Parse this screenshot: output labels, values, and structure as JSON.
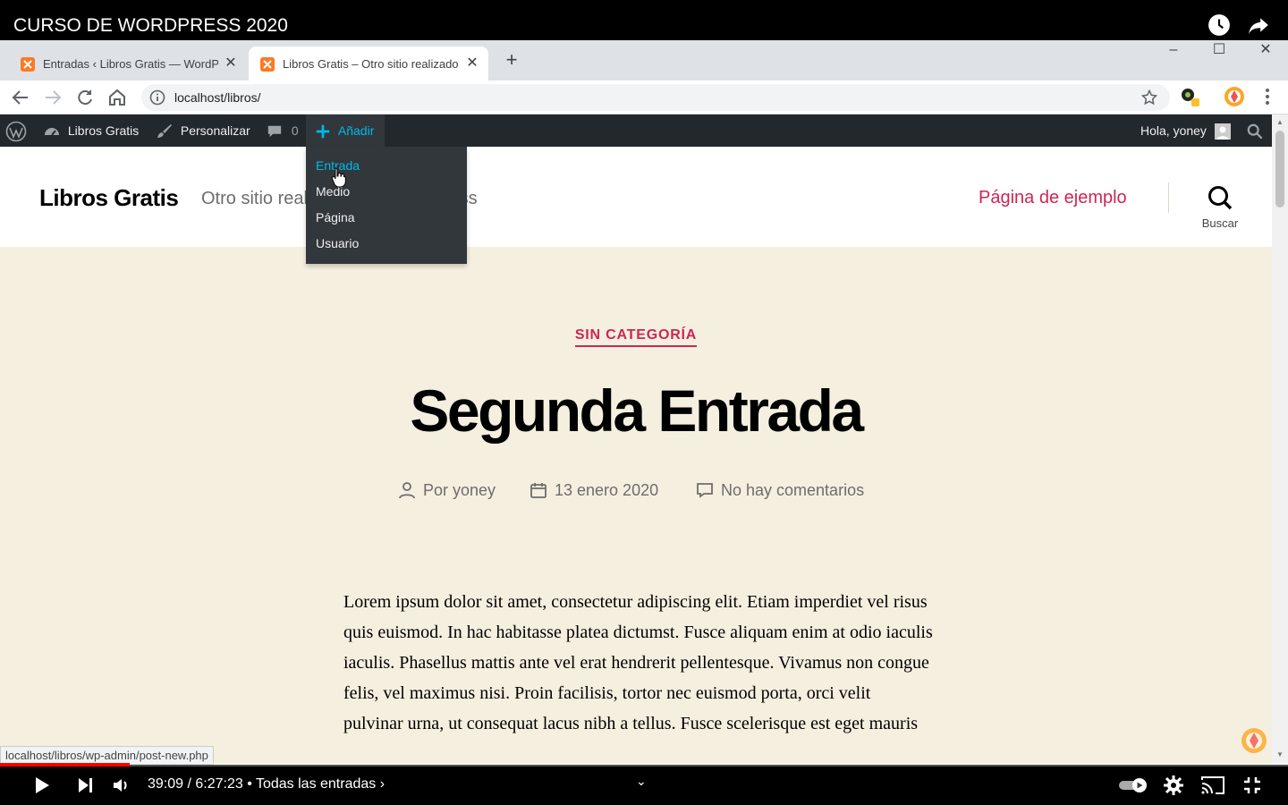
{
  "youtube": {
    "title": "CURSO DE WORDPRESS 2020",
    "time": "39:09 / 6:27:23",
    "chapter": " • Todas las entradas ›",
    "progress_fraction": 0.101
  },
  "browser": {
    "tabs": [
      {
        "label": "Entradas ‹ Libros Gratis — WordPress",
        "active": false
      },
      {
        "label": "Libros Gratis – Otro sitio realizado con WordPress",
        "active": true
      }
    ],
    "url": "localhost/libros/",
    "status_url": "localhost/libros/wp-admin/post-new.php"
  },
  "adminbar": {
    "site_name": "Libros Gratis",
    "customize": "Personalizar",
    "comments_count": "0",
    "add_new": "Añadir",
    "greeting": "Hola, yoney"
  },
  "add_menu": {
    "items": [
      "Entrada",
      "Medio",
      "Página",
      "Usuario"
    ]
  },
  "site": {
    "title": "Libros Gratis",
    "description": "Otro sitio realizado con WordPress",
    "nav_item": "Página de ejemplo",
    "search_label": "Buscar"
  },
  "post": {
    "category": "SIN CATEGORÍA",
    "title": "Segunda Entrada",
    "author": "Por yoney",
    "date": "13 enero 2020",
    "comments": "No hay comentarios",
    "body": "Lorem ipsum dolor sit amet, consectetur adipiscing elit. Etiam imperdiet vel risus quis euismod. In hac habitasse platea dictumst. Fusce aliquam enim at odio iaculis iaculis. Phasellus mattis ante vel erat hendrerit pellentesque. Vivamus non congue felis, vel maximus nisi. Proin facilisis, tortor nec euismod porta, orci velit pulvinar urna, ut consequat lacus nibh a tellus. Fusce scelerisque est eget mauris"
  },
  "colors": {
    "accent": "#cd2653",
    "admin_bar": "#23282d",
    "admin_highlight": "#00b9eb",
    "page_background": "#f5efe0"
  }
}
